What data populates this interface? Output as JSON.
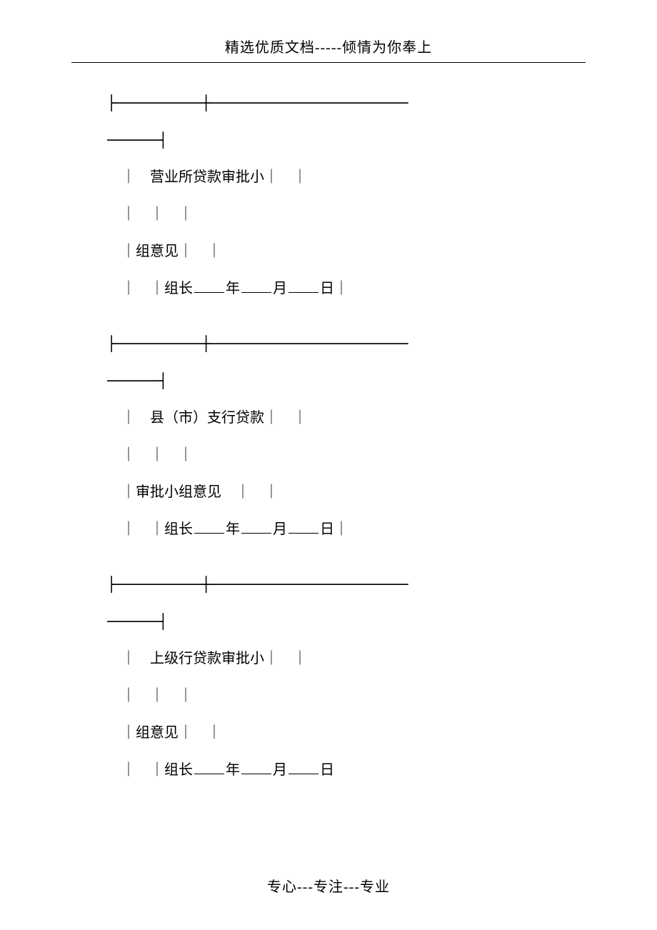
{
  "header": "精选优质文档-----倾情为你奉上",
  "footer": "专心---专注---专业",
  "separator": {
    "top": "├──────────┼───────────────────────",
    "bottom": "──────┤"
  },
  "sections": [
    {
      "line1": "｜　营业所贷款审批小｜　｜",
      "line2": "｜　｜　｜",
      "line3": "｜组意见｜　｜",
      "sig_prefix": "｜　｜组长",
      "y": "年",
      "m": "月",
      "d": "日｜"
    },
    {
      "line1": "｜　县（市）支行贷款｜　｜",
      "line2": "｜　｜　｜",
      "line3": "｜审批小组意见　｜　｜",
      "sig_prefix": "｜　｜组长",
      "y": "年",
      "m": "月",
      "d": "日｜"
    },
    {
      "line1": "｜　上级行贷款审批小｜　｜",
      "line2": "｜　｜　｜",
      "line3": "｜组意见｜　｜",
      "sig_prefix": "｜　｜组长",
      "y": "年",
      "m": "月",
      "d": "日"
    }
  ]
}
